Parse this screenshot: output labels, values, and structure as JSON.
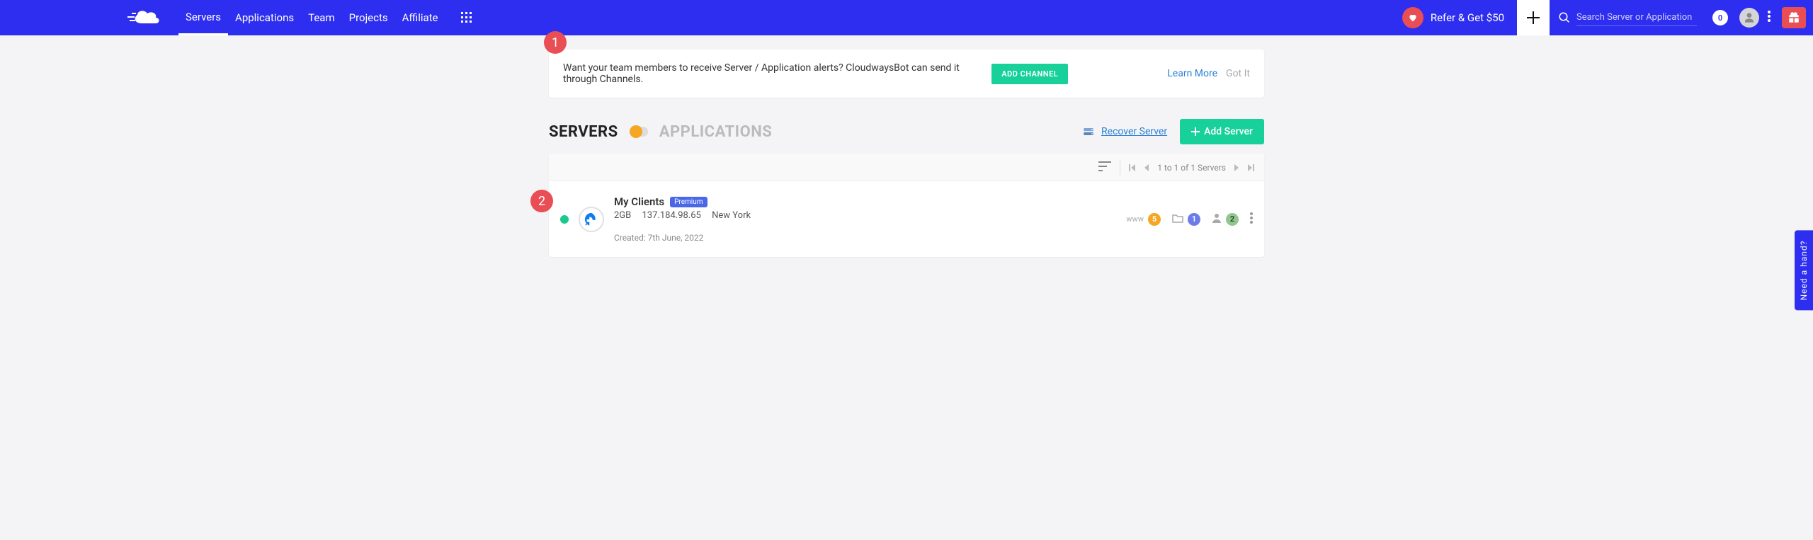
{
  "nav": {
    "items": [
      "Servers",
      "Applications",
      "Team",
      "Projects",
      "Affiliate"
    ],
    "active_index": 0
  },
  "header": {
    "refer_text": "Refer & Get $50",
    "search_placeholder": "Search Server or Application",
    "notification_count": "0"
  },
  "alert": {
    "text": "Want your team members to receive Server / Application alerts? CloudwaysBot can send it through Channels.",
    "add_channel": "ADD CHANNEL",
    "learn_more": "Learn More",
    "got_it": "Got It"
  },
  "tabs": {
    "servers": "SERVERS",
    "applications": "APPLICATIONS"
  },
  "actions": {
    "recover": "Recover Server",
    "add_server": "Add Server"
  },
  "pager": {
    "text": "1 to 1 of 1 Servers"
  },
  "server": {
    "name": "My Clients",
    "badge": "Premium",
    "size": "2GB",
    "ip": "137.184.98.65",
    "location": "New York",
    "created": "Created: 7th June, 2022",
    "www_count": "5",
    "folder_count": "1",
    "user_count": "2"
  },
  "annotations": {
    "one": "1",
    "two": "2"
  },
  "help_tab": "Need a hand?"
}
